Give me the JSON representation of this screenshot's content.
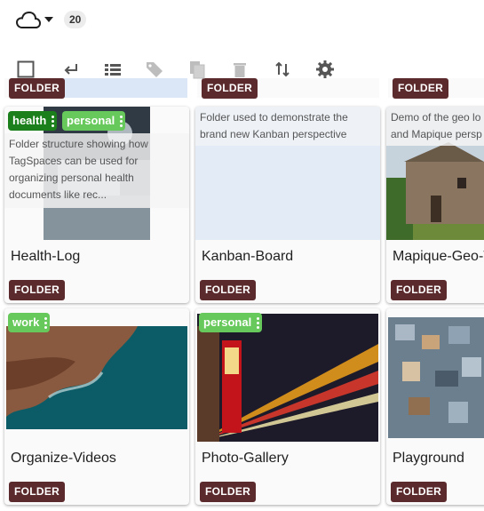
{
  "header": {
    "location_icon": "cloud-icon",
    "dropdown_icon": "caret-down-icon",
    "entry_count": "20"
  },
  "toolbar": {
    "icons": [
      "select-all-checkbox-icon",
      "return-icon",
      "list-view-icon",
      "tag-icon",
      "copy-icon",
      "delete-icon",
      "sort-icon",
      "settings-icon"
    ]
  },
  "peek_row": {
    "label": "FOLDER"
  },
  "cards": [
    {
      "title": "Health-Log",
      "badge": "FOLDER",
      "description": "Folder structure showing how TagSpaces can be used for organizing personal health documents like rec...",
      "tags": [
        {
          "label": "health",
          "color": "#1b7f1b"
        },
        {
          "label": "personal",
          "color": "#67c95b"
        }
      ]
    },
    {
      "title": "Kanban-Board",
      "badge": "FOLDER",
      "description": "Folder used to demonstrate the brand new Kanban perspective",
      "tags": []
    },
    {
      "title": "Mapique-Geo-T",
      "badge": "FOLDER",
      "description": "Demo of the geo lo and Mapique persp",
      "tags": []
    },
    {
      "title": "Organize-Videos",
      "badge": "FOLDER",
      "description": "",
      "tags": [
        {
          "label": "work",
          "color": "#67c95b"
        }
      ]
    },
    {
      "title": "Photo-Gallery",
      "badge": "FOLDER",
      "description": "",
      "tags": [
        {
          "label": "personal",
          "color": "#67c95b"
        }
      ]
    },
    {
      "title": "Playground",
      "badge": "FOLDER",
      "description": "",
      "tags": []
    }
  ]
}
